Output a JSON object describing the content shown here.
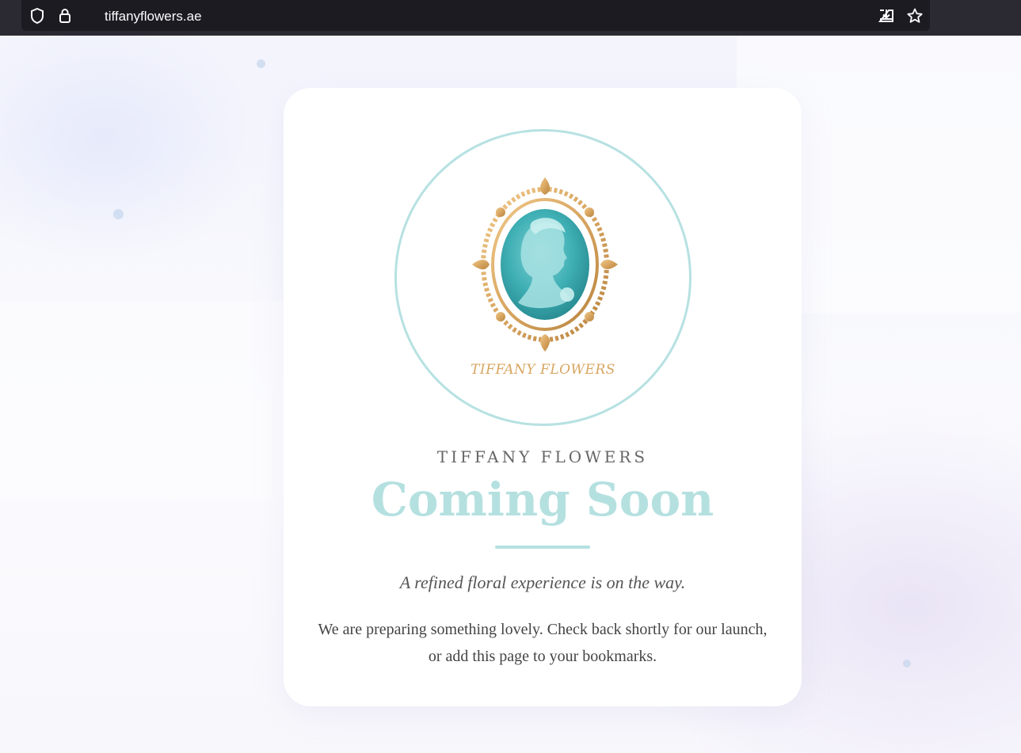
{
  "browser": {
    "url": "tiffanyflowers.ae",
    "icons": [
      "shield-icon",
      "lock-icon",
      "download-icon",
      "star-icon"
    ]
  },
  "logo": {
    "wordmark": "TIFFANY FLOWERS"
  },
  "brand_name": "TIFFANY FLOWERS",
  "headline": "Coming Soon",
  "tagline": "A refined floral experience is on the way.",
  "body": "We are preparing something lovely. Check back shortly for our launch, or add this page to your bookmarks.",
  "colors": {
    "accent": "#b5e0e0",
    "gold": "#d8a560",
    "cameo": "#3fb0b5"
  }
}
